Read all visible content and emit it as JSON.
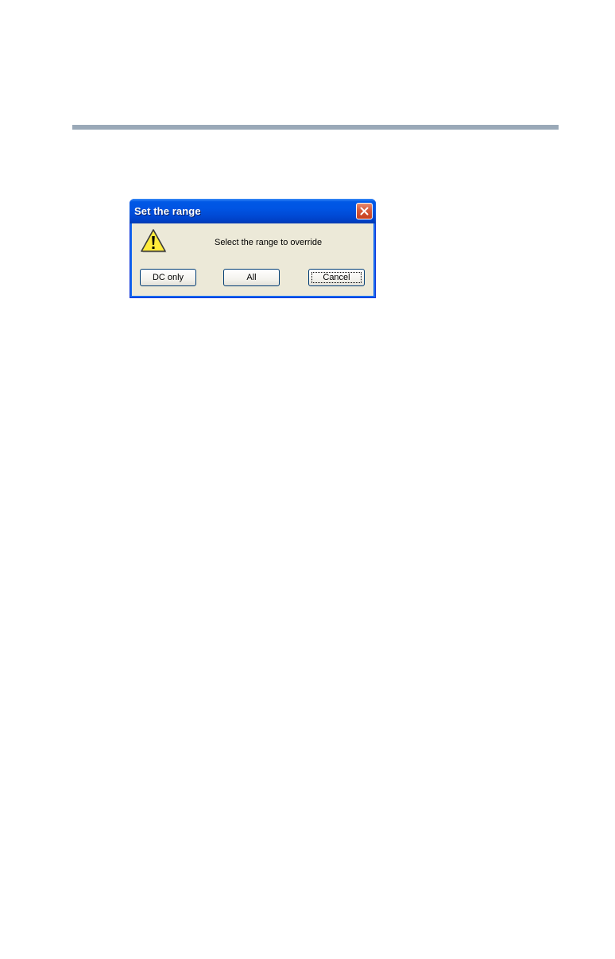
{
  "dialog": {
    "title": "Set the range",
    "message": "Select the range to override",
    "icon": "warning-icon",
    "buttons": {
      "dc_only": "DC only",
      "all": "All",
      "cancel": "Cancel"
    }
  },
  "colors": {
    "titlebar": "#0054e3",
    "close_button": "#d6593a",
    "dialog_face": "#ece9d8",
    "warning_yellow": "#ffeb3b",
    "header_rule": "#9aa9b8"
  }
}
